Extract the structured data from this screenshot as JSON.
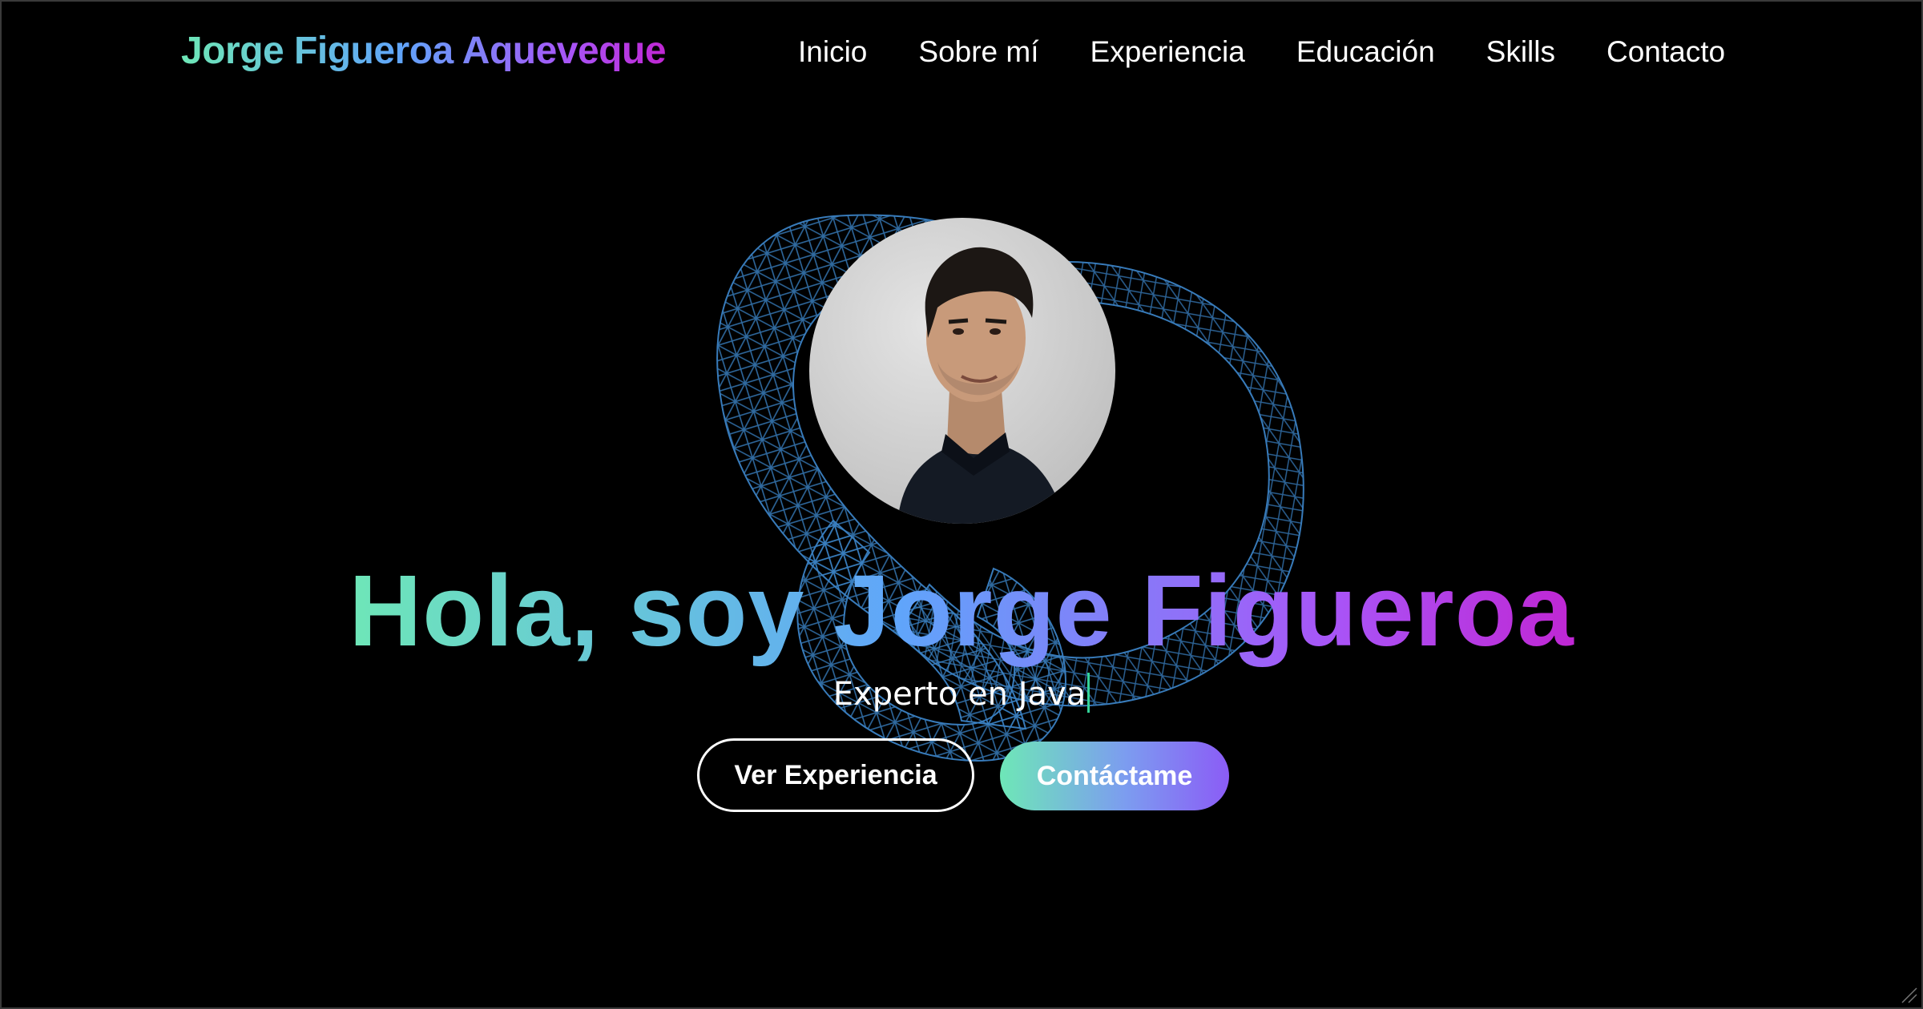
{
  "header": {
    "brand": "Jorge Figueroa Aqueveque",
    "nav": [
      {
        "label": "Inicio"
      },
      {
        "label": "Sobre mí"
      },
      {
        "label": "Experiencia"
      },
      {
        "label": "Educación"
      },
      {
        "label": "Skills"
      },
      {
        "label": "Contacto"
      }
    ]
  },
  "hero": {
    "headline": "Hola, soy Jorge Figueroa",
    "subtitle": "Experto en Java",
    "primary_button": "Ver Experiencia",
    "secondary_button": "Contáctame"
  },
  "colors": {
    "background": "#000000",
    "gradient_start": "#6ee7b7",
    "gradient_mid": "#60a5fa",
    "gradient_end": "#a855f7",
    "wireframe": "#3b82c4"
  }
}
